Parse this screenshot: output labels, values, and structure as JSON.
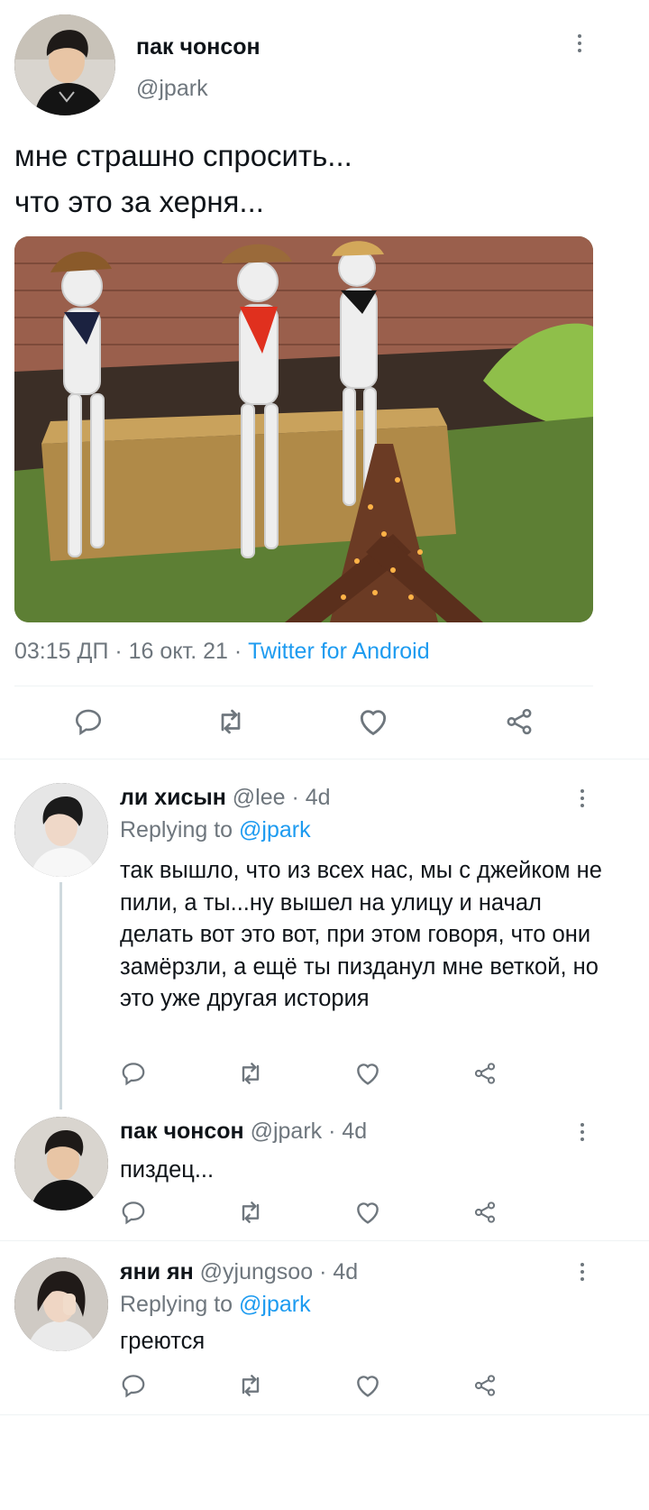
{
  "main_tweet": {
    "author_name": "пак чонсон",
    "author_handle": "@jpark",
    "text_line1": "мне страшно спросить...",
    "text_line2": "что это за херня...",
    "time": "03:15 ДП",
    "sep1": "·",
    "date": "16 окт. 21",
    "sep2": "·",
    "source": "Twitter for Android"
  },
  "replies": [
    {
      "author_name": "ли хисын",
      "author_handle": "@lee",
      "sep": "·",
      "time": "4d",
      "replying_label": "Replying to",
      "replying_handle": "@jpark",
      "text": "так вышло, что из всех нас, мы с джейком не пили, а ты...ну вышел на улицу и начал делать вот это вот, при этом говоря, что они замёрзли, а ещё ты пизданул мне веткой, но это уже другая история"
    },
    {
      "author_name": "пак чонсон",
      "author_handle": "@jpark",
      "sep": "·",
      "time": "4d",
      "text": "пиздец..."
    },
    {
      "author_name": "яни ян",
      "author_handle": "@yjungsoo",
      "sep": "·",
      "time": "4d",
      "replying_label": "Replying to",
      "replying_handle": "@jpark",
      "text": "греются"
    }
  ],
  "icons": {
    "reply": "reply-icon",
    "retweet": "retweet-icon",
    "like": "heart-icon",
    "share": "share-icon",
    "more": "more-vertical-icon"
  },
  "colors": {
    "link": "#1d9bf0",
    "muted": "#6e767d",
    "text": "#0f1419",
    "divider": "#eff3f4"
  }
}
